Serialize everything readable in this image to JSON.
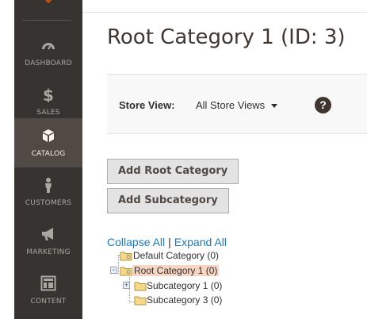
{
  "sidebar": {
    "items": [
      {
        "label": "DASHBOARD",
        "icon": "dashboard-icon"
      },
      {
        "label": "SALES",
        "icon": "dollar-icon"
      },
      {
        "label": "CATALOG",
        "icon": "box-icon",
        "active": true
      },
      {
        "label": "CUSTOMERS",
        "icon": "person-icon"
      },
      {
        "label": "MARKETING",
        "icon": "megaphone-icon"
      },
      {
        "label": "CONTENT",
        "icon": "layout-icon"
      }
    ]
  },
  "page": {
    "title": "Root Category 1 (ID: 3)"
  },
  "store_view": {
    "label": "Store View:",
    "value": "All Store Views",
    "help": "?"
  },
  "buttons": {
    "add_root": "Add Root Category",
    "add_sub": "Add Subcategory"
  },
  "tree_controls": {
    "collapse": "Collapse All",
    "separator": "|",
    "expand": "Expand All"
  },
  "tree": {
    "nodes": [
      {
        "label": "Default Category (0)"
      },
      {
        "label": "Root Category 1 (0)",
        "selected": true,
        "expander": "⊟"
      },
      {
        "label": "Subcategory 1 (0)",
        "expander": "⊞"
      },
      {
        "label": "Subcategory 3 (0)"
      }
    ]
  },
  "colors": {
    "sidebar": "#373330",
    "sidebar_active": "#514943",
    "link": "#1979c3",
    "selection": "#f7d5c3"
  }
}
